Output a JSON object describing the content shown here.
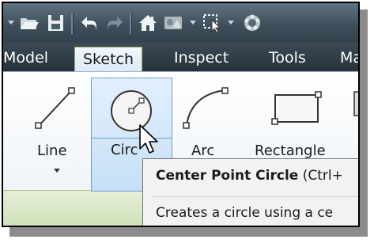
{
  "quick_access": {
    "icons": [
      "open-icon",
      "save-icon",
      "undo-icon",
      "redo-icon",
      "home-icon",
      "appearance-icon",
      "select-icon",
      "materials-icon"
    ]
  },
  "tabs": [
    {
      "label": "Model",
      "active": false
    },
    {
      "label": "Sketch",
      "active": true
    },
    {
      "label": "Inspect",
      "active": false
    },
    {
      "label": "Tools",
      "active": false
    },
    {
      "label": "Ma",
      "active": false
    }
  ],
  "ribbon": {
    "tools": [
      {
        "label": "Line"
      },
      {
        "label": "Circ"
      },
      {
        "label": "Arc"
      },
      {
        "label": "Rectangle"
      }
    ]
  },
  "tooltip": {
    "title_bold": "Center Point Circle",
    "title_shortcut": " (Ctrl+",
    "description": "Creates a circle using a ce"
  },
  "colors": {
    "accent_active_tab": "#92b06a",
    "selection_blue": "#c6dff6",
    "panel_green": "#cfe0b8"
  }
}
